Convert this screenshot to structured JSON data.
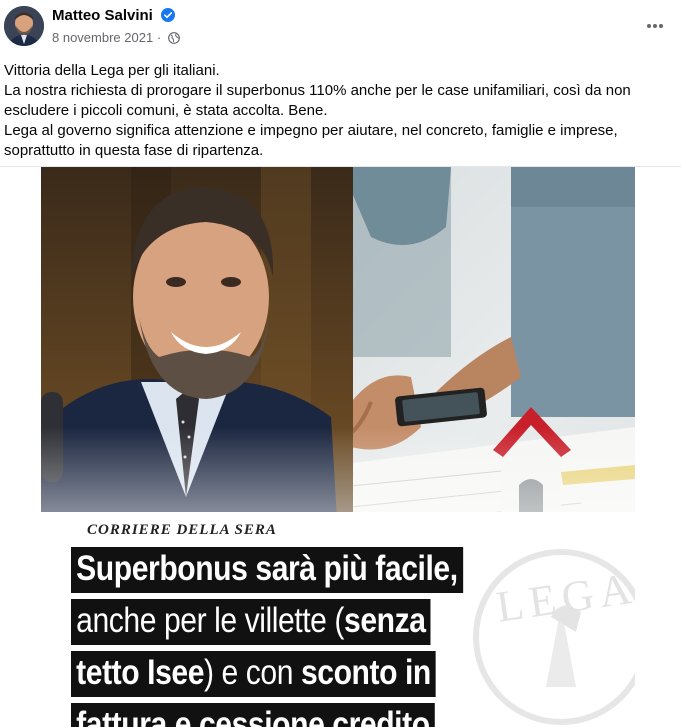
{
  "post": {
    "author": "Matteo Salvini",
    "date": "8 novembre 2021",
    "date_separator": "·",
    "caption_lines": [
      "Vittoria della Lega per gli italiani.",
      "La nostra richiesta di prorogare il superbonus 110% anche per le case unifamiliari, così da non",
      "escludere i piccoli comuni, è stata accolta. Bene.",
      "Lega al governo significa attenzione e impegno per aiutare, nel concreto, famiglie e imprese,",
      "soprattutto in questa fase di ripartenza."
    ]
  },
  "image": {
    "newspaper": "CORRIERE DELLA SERA",
    "headline": {
      "line1": "Superbonus sarà più facile,",
      "line2_regular": "anche per le villette (",
      "line2_bold": "senza",
      "line3_bold": "tetto Isee",
      "line3_regular": ") e con ",
      "line3_bold2": "sconto in",
      "line4": "fattura e cessione credito"
    },
    "watermark": "LEGA"
  },
  "icons": {
    "verified": "verified-badge-icon",
    "globe": "globe-icon",
    "more": "more-options-icon"
  },
  "colors": {
    "verified_blue": "#1877f2",
    "text_primary": "#050505",
    "text_secondary": "#65676b",
    "house_roof": "#c8202a"
  }
}
